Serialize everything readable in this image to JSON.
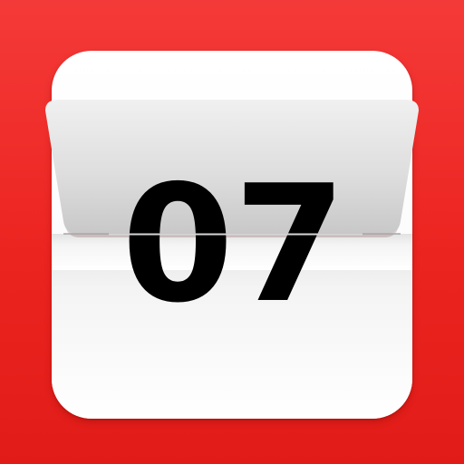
{
  "app": {
    "name": "calendar-date-icon"
  },
  "date": {
    "day": "07"
  },
  "colors": {
    "background_top": "#f43a38",
    "background_bottom": "#e11c18",
    "card": "#ffffff",
    "flap_top": "#ececec",
    "flap_bottom": "#c9c9c9",
    "digits": "#000000"
  }
}
